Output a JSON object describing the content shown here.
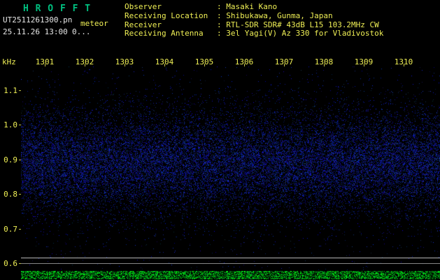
{
  "colors": {
    "background": "#000000",
    "title_green": "#00c080",
    "text_white": "#e8e8e8",
    "text_yellow": "#efef55",
    "noise_blue": "#2233cc",
    "level_green": "#00dd00"
  },
  "app": {
    "title": "H R O F F T",
    "filename": "UT2511261300.pn",
    "mode": "meteor",
    "datetime": "25.11.26 13:00",
    "counter": "0..."
  },
  "station": {
    "separator": ":",
    "rows": [
      {
        "label": "Observer",
        "value": "Masaki Kano"
      },
      {
        "label": "Receiving Location",
        "value": "Shibukawa, Gunma, Japan"
      },
      {
        "label": "Receiver",
        "value": "RTL-SDR SDR# 43dB L15 103.2MHz CW"
      },
      {
        "label": "Receiving Antenna",
        "value": "3el Yagi(V) Az 330 for Vladivostok"
      }
    ]
  },
  "axes": {
    "y_unit": "kHz",
    "y_ticks": [
      "1.1",
      "1.0",
      "0.9",
      "0.8",
      "0.7",
      "0.6"
    ],
    "x_ticks": [
      "1301",
      "1302",
      "1303",
      "1304",
      "1305",
      "1306",
      "1307",
      "1308",
      "1309",
      "1310"
    ]
  },
  "chart_data": {
    "type": "heatmap",
    "title": "HROFFT meteor echo spectrogram",
    "x_tick_labels_time": [
      "1301",
      "1302",
      "1303",
      "1304",
      "1305",
      "1306",
      "1307",
      "1308",
      "1309",
      "1310"
    ],
    "y_unit": "kHz",
    "y_tick_labels": [
      "1.1",
      "1.0",
      "0.9",
      "0.8",
      "0.7",
      "0.6"
    ],
    "y_range": [
      0.58,
      1.17
    ],
    "noise_band_khz": [
      0.78,
      1.02
    ],
    "noise_band_peak_khz": 0.9,
    "marker_lines_khz": [
      0.62,
      0.6
    ],
    "echoes": "none visible - background noise only",
    "bottom_strip": "green signal-level noise band"
  }
}
